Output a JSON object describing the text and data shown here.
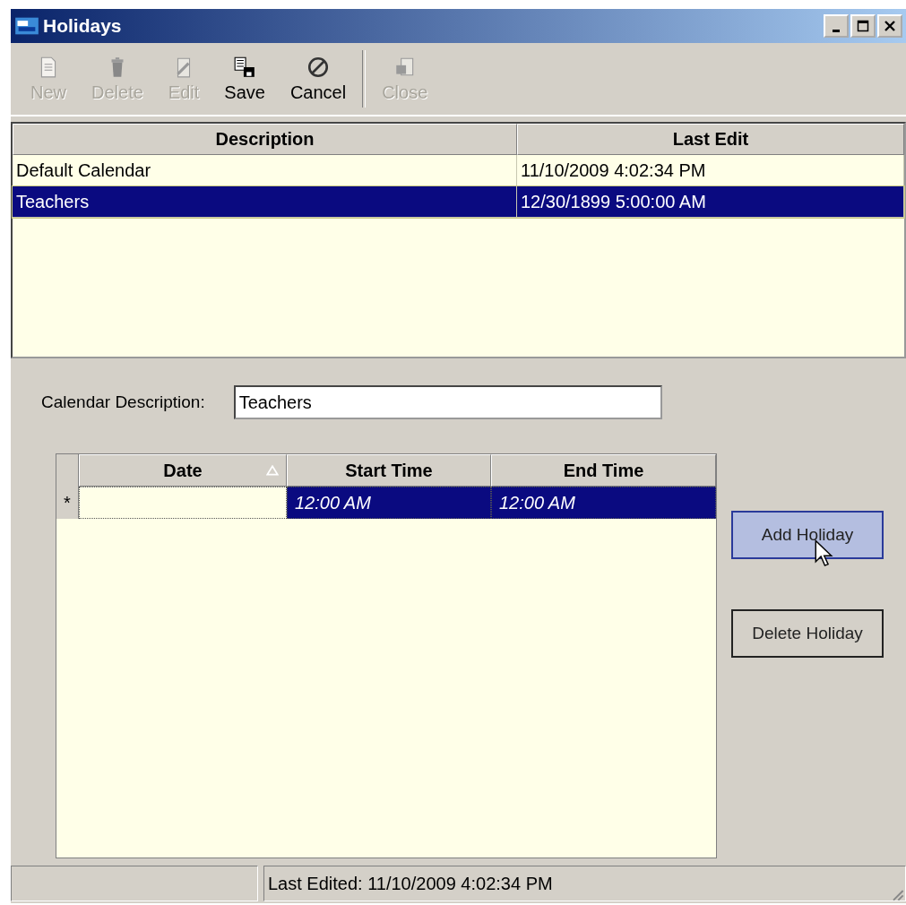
{
  "window": {
    "title": "Holidays"
  },
  "toolbar": [
    {
      "label": "New",
      "kind": "new",
      "disabled": true
    },
    {
      "label": "Delete",
      "kind": "delete",
      "disabled": true
    },
    {
      "label": "Edit",
      "kind": "edit",
      "disabled": true
    },
    {
      "label": "Save",
      "kind": "save",
      "disabled": false
    },
    {
      "label": "Cancel",
      "kind": "cancel",
      "disabled": false
    },
    {
      "label": "Close",
      "kind": "close",
      "disabled": true,
      "separator_before": true
    }
  ],
  "calendars": {
    "columns": [
      "Description",
      "Last Edit"
    ],
    "rows": [
      {
        "description": "Default Calendar",
        "last_edit": "11/10/2009 4:02:34 PM",
        "selected": false
      },
      {
        "description": "Teachers",
        "last_edit": "12/30/1899 5:00:00 AM",
        "selected": true
      }
    ]
  },
  "calendar_description": {
    "label": "Calendar Description:",
    "value": "Teachers"
  },
  "holidays": {
    "columns": [
      {
        "label": "Date",
        "sorted": true
      },
      {
        "label": "Start Time",
        "sorted": false
      },
      {
        "label": "End Time",
        "sorted": false
      }
    ],
    "rows": [
      {
        "marker": "*",
        "start_time": "12:00 AM",
        "end_time": "12:00 AM",
        "selected": true
      }
    ]
  },
  "buttons": [
    {
      "label": "Add Holiday",
      "hovered": true
    },
    {
      "label": "Delete Holiday",
      "hovered": false
    }
  ],
  "status_bar": {
    "text": "Last Edited: 11/10/2009 4:02:34 PM"
  }
}
